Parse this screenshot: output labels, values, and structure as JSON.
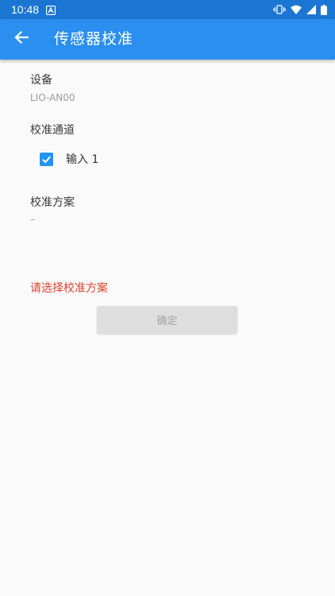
{
  "status_bar": {
    "time": "10:48",
    "icons": [
      "app-notification-icon",
      "vibrate-icon",
      "wifi-icon",
      "cell-signal-icon",
      "battery-icon"
    ]
  },
  "app_bar": {
    "title": "传感器校准",
    "back_icon": "arrow-left-icon"
  },
  "device": {
    "label": "设备",
    "value": "LIO-AN00"
  },
  "channel": {
    "label": "校准通道",
    "options": [
      {
        "label": "输入 1",
        "checked": true
      }
    ]
  },
  "scheme": {
    "label": "校准方案",
    "value": "–"
  },
  "error_message": "请选择校准方案",
  "confirm_button": {
    "label": "确定",
    "enabled": false
  },
  "colors": {
    "status_bar": "#1b76d3",
    "app_bar": "#2b8ff0",
    "checkbox": "#2196f3",
    "error": "#e0402d",
    "button_disabled": "#dedede"
  }
}
